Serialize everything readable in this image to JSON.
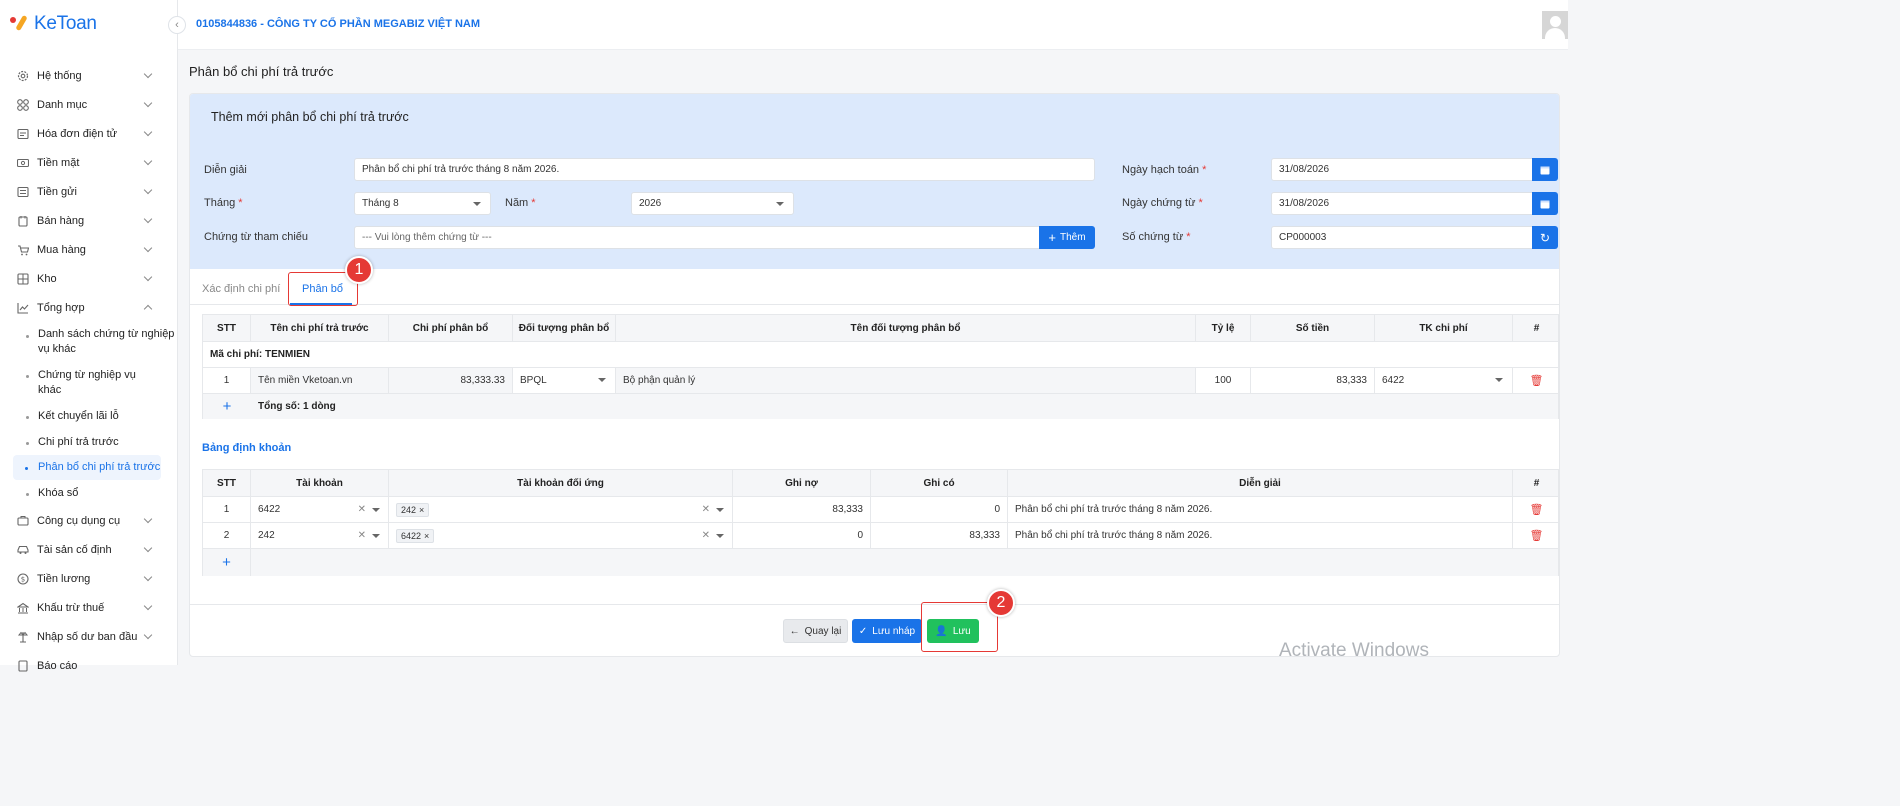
{
  "brand": {
    "name": "KeToan"
  },
  "header": {
    "company": "0105844836 - CÔNG TY CỔ PHẦN MEGABIZ VIỆT NAM"
  },
  "sidebar": {
    "items": [
      {
        "label": "Hệ thống",
        "icon": "gear-icon"
      },
      {
        "label": "Danh mục",
        "icon": "grid-icon"
      },
      {
        "label": "Hóa đơn điện tử",
        "icon": "invoice-icon"
      },
      {
        "label": "Tiền mặt",
        "icon": "cash-icon"
      },
      {
        "label": "Tiền gửi",
        "icon": "bank-icon"
      },
      {
        "label": "Bán hàng",
        "icon": "sales-icon"
      },
      {
        "label": "Mua hàng",
        "icon": "purchase-icon"
      },
      {
        "label": "Kho",
        "icon": "warehouse-icon"
      },
      {
        "label": "Tổng hợp",
        "icon": "chart-icon"
      }
    ],
    "subitems": [
      {
        "label": "Danh sách chứng từ nghiệp vụ khác"
      },
      {
        "label": "Chứng từ nghiệp vụ khác"
      },
      {
        "label": "Kết chuyển lãi lỗ"
      },
      {
        "label": "Chi phí trả trước"
      },
      {
        "label": "Phân bổ chi phí trả trước"
      },
      {
        "label": "Khóa sổ"
      }
    ],
    "items_after": [
      {
        "label": "Công cụ dụng cụ",
        "icon": "tools-icon"
      },
      {
        "label": "Tài sản cố định",
        "icon": "car-icon"
      },
      {
        "label": "Tiền lương",
        "icon": "salary-icon"
      },
      {
        "label": "Khấu trừ thuế",
        "icon": "tax-icon"
      },
      {
        "label": "Nhập số dư ban đầu",
        "icon": "balance-icon"
      },
      {
        "label": "Báo cáo",
        "icon": "report-icon"
      }
    ]
  },
  "page": {
    "title": "Phân bổ chi phí trả trước"
  },
  "form": {
    "title": "Thêm mới phân bổ chi phí trả trước",
    "dien_giai_label": "Diễn giải",
    "dien_giai_value": "Phân bổ chi phí trả trước tháng 8 năm 2026.",
    "thang_label": "Tháng",
    "thang_value": "Tháng 8",
    "nam_label": "Năm",
    "nam_value": "2026",
    "ref_label": "Chứng từ tham chiếu",
    "ref_placeholder": "--- Vui lòng thêm chứng từ ---",
    "add_label": "Thêm",
    "ngay_hach_toan_label": "Ngày hạch toán",
    "ngay_hach_toan_value": "31/08/2026",
    "ngay_chung_tu_label": "Ngày chứng từ",
    "ngay_chung_tu_value": "31/08/2026",
    "so_chung_tu_label": "Số chứng từ",
    "so_chung_tu_value": "CP000003",
    "required_mark": "*"
  },
  "tabs": {
    "tab1": "Xác định chi phí",
    "tab2": "Phân bổ"
  },
  "alloc_table": {
    "headers": [
      "STT",
      "Tên chi phí trả trước",
      "Chi phí phân bổ",
      "Đối tượng phân bổ",
      "Tên đối tượng phân bổ",
      "Tỷ lệ",
      "Số tiền",
      "TK chi phí",
      "#"
    ],
    "group": "Mã chi phí: TENMIEN",
    "row": {
      "stt": "1",
      "ten": "Tên miền Vketoan.vn",
      "chi_phi": "83,333.33",
      "doi_tuong": "BPQL",
      "ten_doi_tuong": "Bộ phận quản lý",
      "ty_le": "100",
      "so_tien": "83,333",
      "tk": "6422"
    },
    "total": "Tổng số: 1 dòng"
  },
  "entry_section": {
    "title": "Bảng định khoản"
  },
  "entry_table": {
    "headers": [
      "STT",
      "Tài khoản",
      "Tài khoản đối ứng",
      "Ghi nợ",
      "Ghi có",
      "Diễn giải",
      "#"
    ],
    "rows": [
      {
        "stt": "1",
        "tk": "6422",
        "du": "242",
        "no": "83,333",
        "co": "0",
        "dg": "Phân bổ chi phí trả trước tháng 8 năm 2026."
      },
      {
        "stt": "2",
        "tk": "242",
        "du": "6422",
        "no": "0",
        "co": "83,333",
        "dg": "Phân bổ chi phí trả trước tháng 8 năm 2026."
      }
    ]
  },
  "footer": {
    "back": "Quay lại",
    "draft": "Lưu nháp",
    "save": "Lưu"
  },
  "annotations": {
    "one": "1",
    "two": "2"
  },
  "watermark": "Activate Windows",
  "colors": {
    "primary": "#1a73e8",
    "success": "#21c15d",
    "danger": "#e53935"
  }
}
